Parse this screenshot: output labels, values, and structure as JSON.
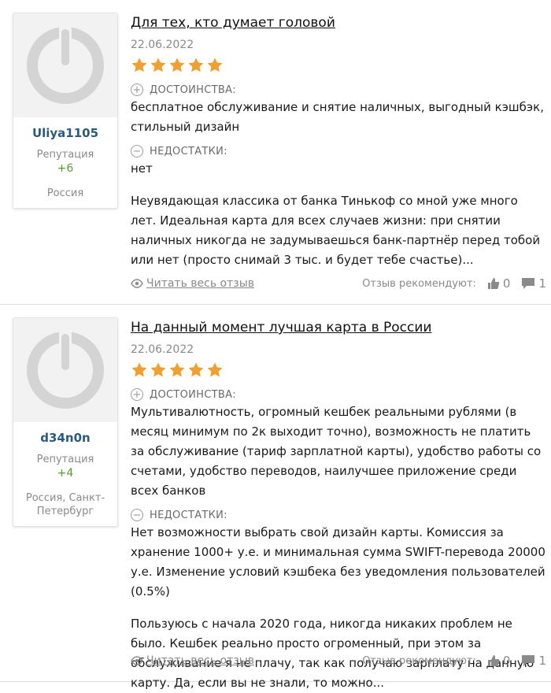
{
  "reviews": [
    {
      "username": "Uliya1105",
      "rep_label": "Репутация",
      "rep_value": "+6",
      "location": "Россия",
      "title": "Для тех, кто думает головой",
      "date": "22.06.2022",
      "rating": 5,
      "pros_label": "ДОСТОИНСТВА:",
      "pros_text": "бесплатное обслуживание и снятие наличных, выгодный кэшбэк, стильный дизайн",
      "cons_label": "НЕДОСТАТКИ:",
      "cons_text": "нет",
      "summary": "Неувядающая классика от банка Тинькоф со мной уже много лет. Идеальная карта для всех случаев жизни: при снятии наличных никогда не задумываешься банк-партнёр перед тобой или нет (просто снимай 3 тыс. и будет тебе счастье)...",
      "read_more": "Читать весь отзыв",
      "recommend_label": "Отзыв рекомендуют:",
      "likes": "0",
      "comments": "1"
    },
    {
      "username": "d34n0n",
      "rep_label": "Репутация",
      "rep_value": "+4",
      "location": "Россия, Санкт-Петербург",
      "title": "На данный момент лучшая карта в России",
      "date": "22.06.2022",
      "rating": 5,
      "pros_label": "ДОСТОИНСТВА:",
      "pros_text": "Мультивалютность, огромный кешбек реальными рублями (в месяц минимум по 2к выходит точно), возможность не платить за обслуживание (тариф зарплатной карты), удобство работы со счетами, удобство переводов, наилучшее приложение среди всех банков",
      "cons_label": "НЕДОСТАТКИ:",
      "cons_text": "Нет возможности выбрать свой дизайн карты. Комиссия за хранение 1000+ у.е. и минимальная сумма SWIFT-перевода 20000 у.е. Изменение условий кэшбека без уведомления пользователей (0.5%)",
      "summary": "Пользуюсь с начала 2020 года, никогда никаких проблем не было. Кешбек реально просто огроменный, при этом за обслуживание я не плачу, так как получаю зарплату на данную карту. Да, если вы не знали, то можно...",
      "read_more": "Читать весь отзыв",
      "recommend_label": "Отзыв рекомендуют:",
      "likes": "0",
      "comments": "1"
    }
  ],
  "colors": {
    "star": "#f0a030",
    "username": "#2b5a7a",
    "reputation": "#5a9a3a",
    "muted": "#8a8a8a",
    "divider": "#dcdcdc"
  },
  "icons": [
    "default-avatar-icon",
    "star-icon",
    "plus-circle-icon",
    "minus-circle-icon",
    "eye-icon",
    "thumbs-up-icon",
    "comment-icon"
  ]
}
